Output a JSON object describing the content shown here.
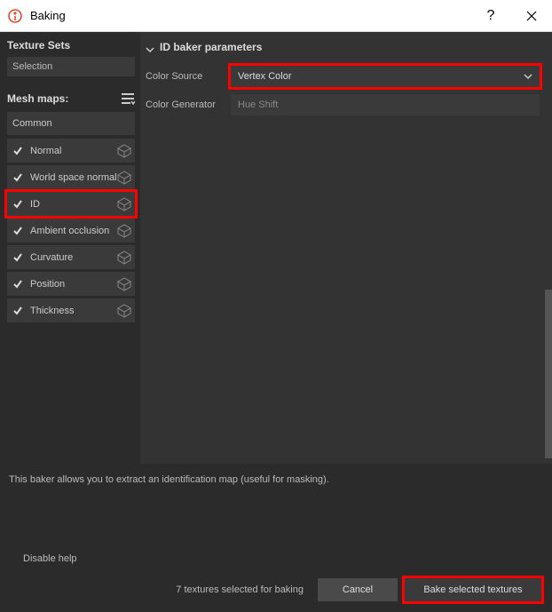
{
  "window": {
    "title": "Baking"
  },
  "left": {
    "texture_sets_label": "Texture Sets",
    "selection_value": "Selection",
    "mesh_maps_label": "Mesh maps:",
    "group_label": "Common",
    "maps": [
      {
        "label": "Normal",
        "checked": true,
        "highlight": false
      },
      {
        "label": "World space normal",
        "checked": true,
        "highlight": false
      },
      {
        "label": "ID",
        "checked": true,
        "highlight": true
      },
      {
        "label": "Ambient occlusion",
        "checked": true,
        "highlight": false
      },
      {
        "label": "Curvature",
        "checked": true,
        "highlight": false
      },
      {
        "label": "Position",
        "checked": true,
        "highlight": false
      },
      {
        "label": "Thickness",
        "checked": true,
        "highlight": false
      }
    ]
  },
  "params": {
    "header": "ID baker parameters",
    "color_source_label": "Color Source",
    "color_source_value": "Vertex Color",
    "color_generator_label": "Color Generator",
    "color_generator_value": "Hue Shift"
  },
  "description": "This baker allows you to extract an identification map (useful for masking).",
  "disable_help": "Disable help",
  "footer": {
    "status": "7 textures selected for baking",
    "cancel": "Cancel",
    "bake": "Bake selected textures"
  }
}
